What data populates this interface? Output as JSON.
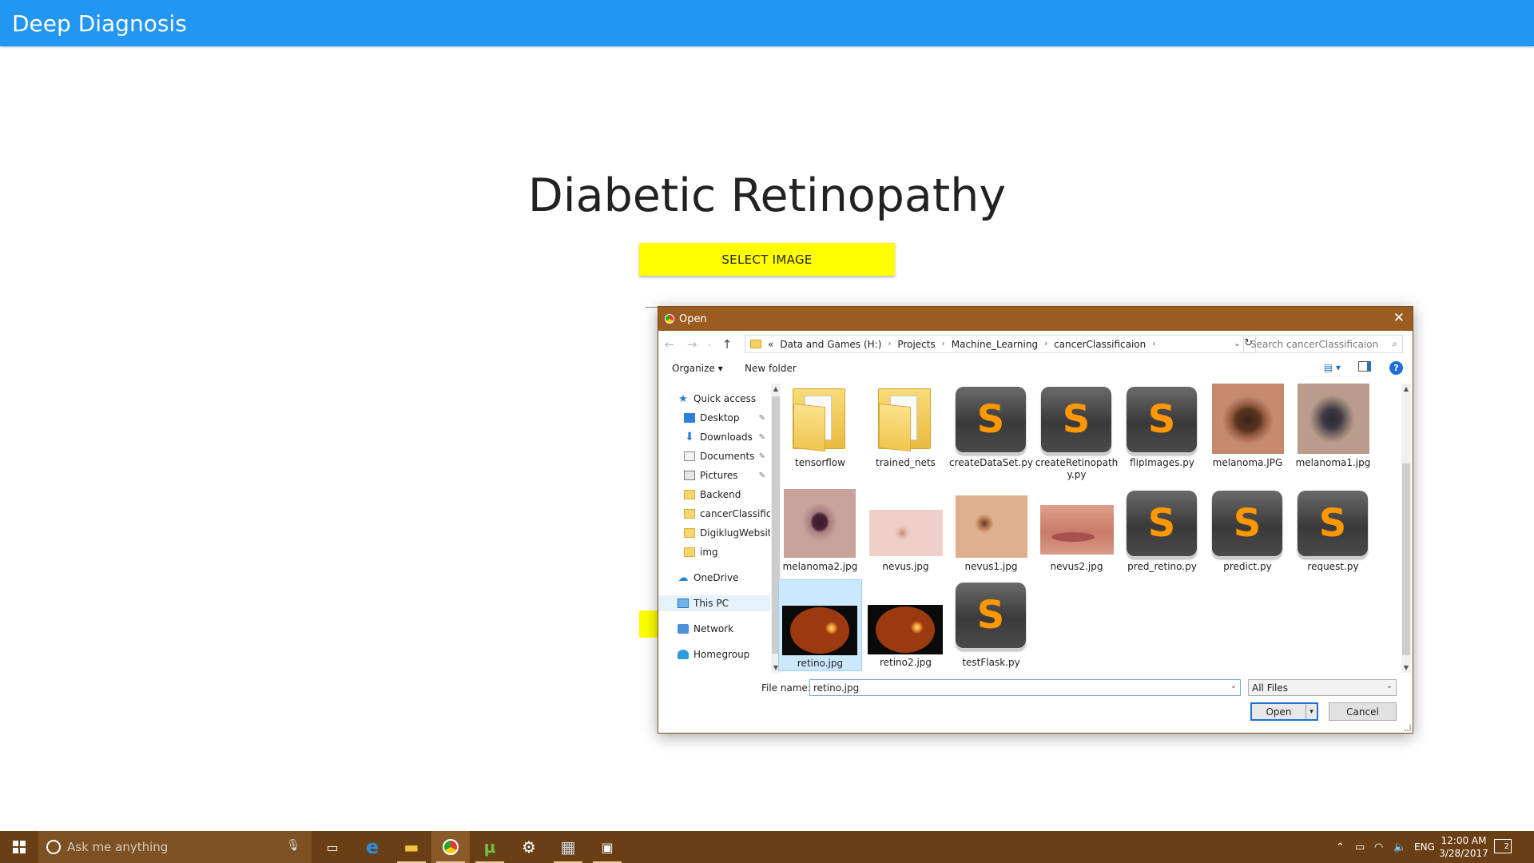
{
  "app": {
    "title": "Deep Diagnosis",
    "heading": "Diabetic Retinopathy",
    "select_button": "SELECT IMAGE",
    "accent": "#2196f3",
    "button_color": "#ffff00"
  },
  "dialog": {
    "title": "Open",
    "breadcrumb": [
      "«",
      "Data and Games (H:)",
      "Projects",
      "Machine_Learning",
      "cancerClassificaion"
    ],
    "search_placeholder": "Search cancerClassificaion",
    "toolbar": {
      "organize": "Organize ▾",
      "new_folder": "New folder",
      "help": "?"
    },
    "nav": [
      {
        "label": "Quick access",
        "icon": "star-icon"
      },
      {
        "label": "Desktop",
        "icon": "desktop-icon",
        "pinned": true
      },
      {
        "label": "Downloads",
        "icon": "download-icon",
        "pinned": true
      },
      {
        "label": "Documents",
        "icon": "documents-icon",
        "pinned": true
      },
      {
        "label": "Pictures",
        "icon": "pictures-icon",
        "pinned": true
      },
      {
        "label": "Backend",
        "icon": "folder-icon"
      },
      {
        "label": "cancerClassificai",
        "icon": "folder-icon"
      },
      {
        "label": "DigiklugWebsite",
        "icon": "folder-icon"
      },
      {
        "label": "img",
        "icon": "folder-icon"
      },
      {
        "label": "OneDrive",
        "icon": "cloud-icon"
      },
      {
        "label": "This PC",
        "icon": "computer-icon",
        "selected": true
      },
      {
        "label": "Network",
        "icon": "network-icon"
      },
      {
        "label": "Homegroup",
        "icon": "homegroup-icon"
      }
    ],
    "files": [
      {
        "name": "tensorflow",
        "kind": "folder"
      },
      {
        "name": "trained_nets",
        "kind": "folder"
      },
      {
        "name": "createDataSet.py",
        "kind": "sublime"
      },
      {
        "name": "createRetinopath y.py",
        "kind": "sublime"
      },
      {
        "name": "flipImages.py",
        "kind": "sublime"
      },
      {
        "name": "melanoma.JPG",
        "kind": "photo"
      },
      {
        "name": "melanoma1.jpg",
        "kind": "photo"
      },
      {
        "name": "melanoma2.jpg",
        "kind": "photo"
      },
      {
        "name": "nevus.jpg",
        "kind": "photo"
      },
      {
        "name": "nevus1.jpg",
        "kind": "photo"
      },
      {
        "name": "nevus2.jpg",
        "kind": "photo"
      },
      {
        "name": "pred_retino.py",
        "kind": "sublime"
      },
      {
        "name": "predict.py",
        "kind": "sublime"
      },
      {
        "name": "request.py",
        "kind": "sublime"
      },
      {
        "name": "retino.jpg",
        "kind": "photo",
        "selected": true
      },
      {
        "name": "retino2.jpg",
        "kind": "photo"
      },
      {
        "name": "testFlask.py",
        "kind": "sublime"
      }
    ],
    "sublime_glyph": "S",
    "file_name_label": "File name:",
    "file_name_value": "retino.jpg",
    "filter": "All Files",
    "open_button": "Open",
    "cancel_button": "Cancel"
  },
  "taskbar": {
    "search_placeholder": "Ask me anything",
    "language": "ENG",
    "time": "12:00 AM",
    "date": "3/28/2017",
    "notification_count": "2",
    "color": "#6b3f16"
  }
}
